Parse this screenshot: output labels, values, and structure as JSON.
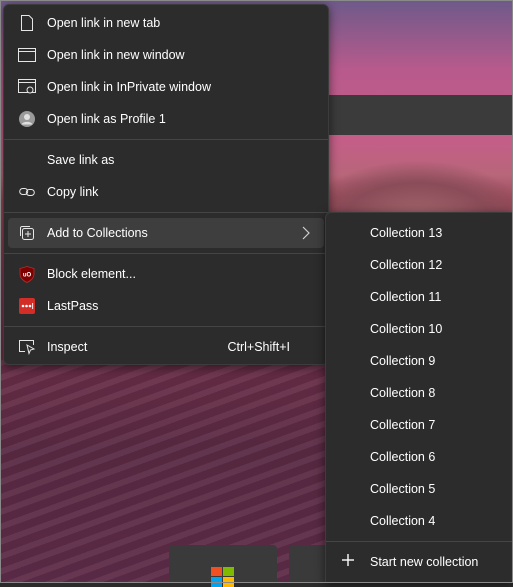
{
  "context_menu": {
    "items": [
      {
        "label": "Open link in new tab",
        "icon": "new-tab-icon"
      },
      {
        "label": "Open link in new window",
        "icon": "new-window-icon"
      },
      {
        "label": "Open link in InPrivate window",
        "icon": "inprivate-window-icon"
      },
      {
        "label": "Open link as Profile 1",
        "icon": "profile-avatar-icon"
      },
      {
        "label": "Save link as",
        "icon": ""
      },
      {
        "label": "Copy link",
        "icon": "link-icon"
      },
      {
        "label": "Add to Collections",
        "icon": "collections-icon"
      },
      {
        "label": "Block element...",
        "icon": "ublock-icon"
      },
      {
        "label": "LastPass",
        "icon": "lastpass-icon"
      },
      {
        "label": "Inspect",
        "icon": "inspect-icon",
        "shortcut": "Ctrl+Shift+I"
      }
    ]
  },
  "collections_submenu": {
    "items": [
      "Collection 13",
      "Collection 12",
      "Collection 11",
      "Collection 10",
      "Collection 9",
      "Collection 8",
      "Collection 7",
      "Collection 6",
      "Collection 5",
      "Collection 4"
    ],
    "new_collection_label": "Start new collection"
  },
  "colors": {
    "menu_bg": "#2c2c2c",
    "hover_bg": "#3e3e3e",
    "ublock_red": "#800000",
    "lastpass_red": "#d32d27"
  }
}
